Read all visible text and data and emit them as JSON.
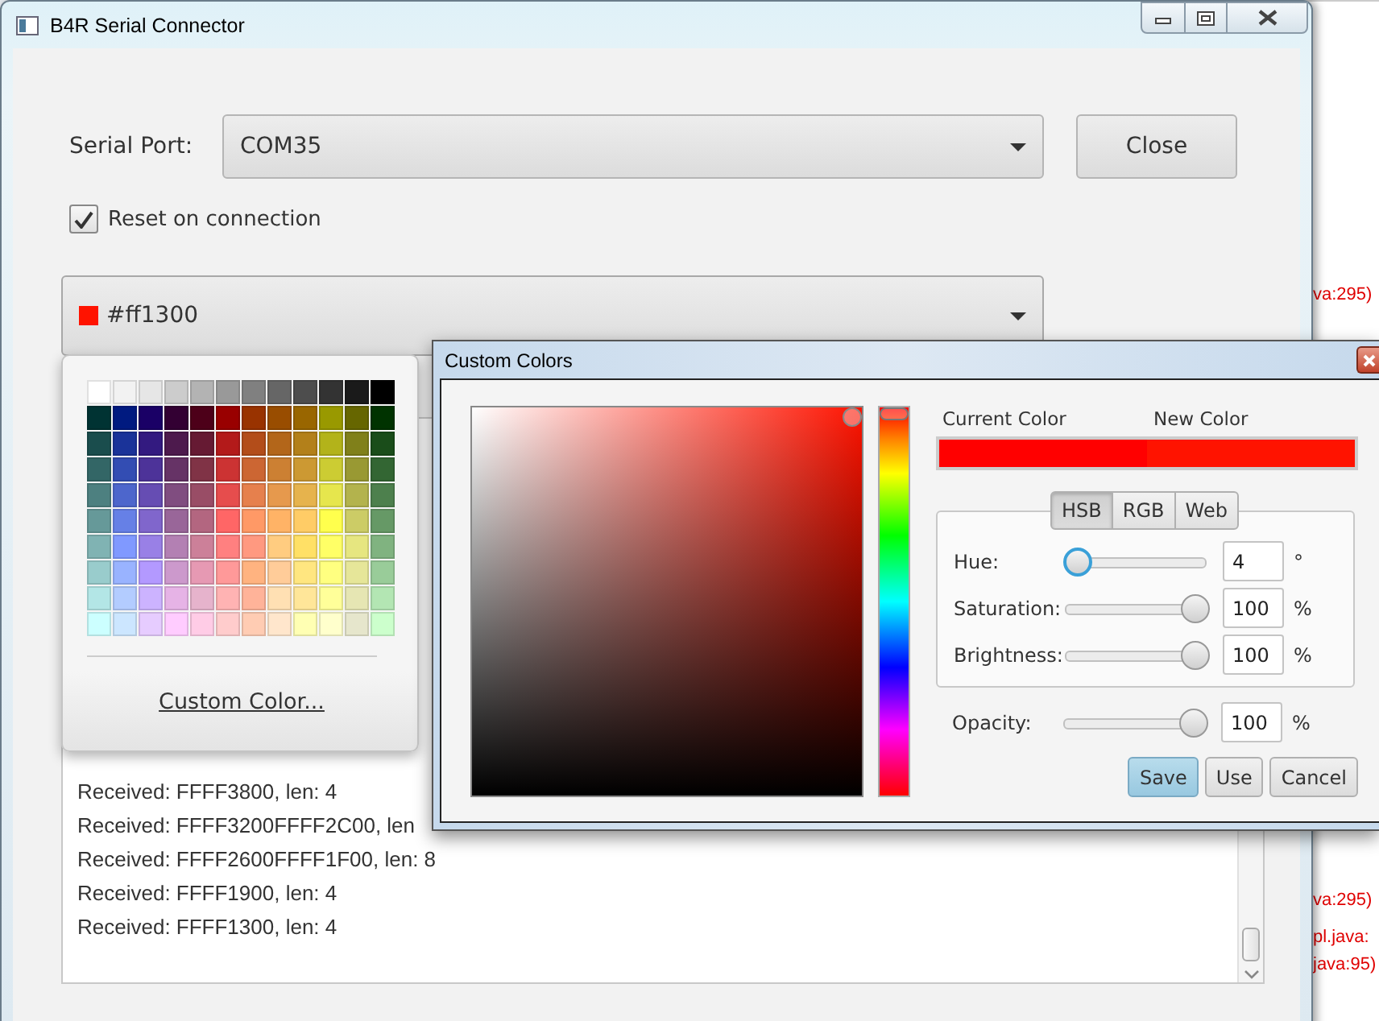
{
  "background_app": {
    "lines": [
      "va:295)",
      "va:295)",
      "pl.java:",
      "java:95)"
    ]
  },
  "window": {
    "title": "B4R Serial Connector"
  },
  "serial_port": {
    "label": "Serial Port:",
    "value": "COM35"
  },
  "close_button": "Close",
  "reset_checkbox": {
    "label": "Reset on connection",
    "checked": true
  },
  "color_picker": {
    "value": "#ff1300",
    "color": "#ff1300",
    "expanded": true
  },
  "log": {
    "lines": [
      "Received: FFFF3800, len: 4",
      "Received: FFFF3200FFFF2C00, len",
      "Received: FFFF2600FFFF1F00, len: 8",
      "Received: FFFF1900, len: 4",
      "Received: FFFF1300, len: 4"
    ]
  },
  "palette": {
    "rows": [
      {
        "swatches": [
          {
            "color": "#ffffff"
          },
          {
            "color": "#f2f2f2"
          },
          {
            "color": "#e6e6e6"
          },
          {
            "color": "#cccccc"
          },
          {
            "color": "#b3b3b3"
          },
          {
            "color": "#999999"
          },
          {
            "color": "#808080"
          },
          {
            "color": "#666666"
          },
          {
            "color": "#4d4d4d"
          },
          {
            "color": "#333333"
          },
          {
            "color": "#1a1a1a"
          },
          {
            "color": "#000000"
          }
        ]
      },
      {
        "swatches": [
          {
            "color": "#003333"
          },
          {
            "color": "#001a80"
          },
          {
            "color": "#1a0066"
          },
          {
            "color": "#330033"
          },
          {
            "color": "#4d0019"
          },
          {
            "color": "#990000"
          },
          {
            "color": "#993300"
          },
          {
            "color": "#994d00"
          },
          {
            "color": "#996600"
          },
          {
            "color": "#999900"
          },
          {
            "color": "#666600"
          },
          {
            "color": "#003300"
          }
        ]
      },
      {
        "swatches": [
          {
            "color": "#1a4d4d"
          },
          {
            "color": "#1a3399"
          },
          {
            "color": "#331a80"
          },
          {
            "color": "#4d1a4d"
          },
          {
            "color": "#661a33"
          },
          {
            "color": "#b31a1a"
          },
          {
            "color": "#b34d1a"
          },
          {
            "color": "#b3661a"
          },
          {
            "color": "#b3801a"
          },
          {
            "color": "#b3b31a"
          },
          {
            "color": "#80801a"
          },
          {
            "color": "#1a4d1a"
          }
        ]
      },
      {
        "swatches": [
          {
            "color": "#336666"
          },
          {
            "color": "#334db3"
          },
          {
            "color": "#4d3399"
          },
          {
            "color": "#663366"
          },
          {
            "color": "#803346"
          },
          {
            "color": "#cc3333"
          },
          {
            "color": "#cc6633"
          },
          {
            "color": "#cc8033"
          },
          {
            "color": "#cc9933"
          },
          {
            "color": "#cccc33"
          },
          {
            "color": "#999933"
          },
          {
            "color": "#336633"
          }
        ]
      },
      {
        "swatches": [
          {
            "color": "#4d8080"
          },
          {
            "color": "#4d66cc"
          },
          {
            "color": "#664db3"
          },
          {
            "color": "#804d80"
          },
          {
            "color": "#994d66"
          },
          {
            "color": "#e64d4d"
          },
          {
            "color": "#e6804d"
          },
          {
            "color": "#e6994d"
          },
          {
            "color": "#e6b34d"
          },
          {
            "color": "#e6e64d"
          },
          {
            "color": "#b3b34d"
          },
          {
            "color": "#4d804d"
          }
        ]
      },
      {
        "swatches": [
          {
            "color": "#669999"
          },
          {
            "color": "#6680e6"
          },
          {
            "color": "#8066cc"
          },
          {
            "color": "#996699"
          },
          {
            "color": "#b36680"
          },
          {
            "color": "#ff6666"
          },
          {
            "color": "#ff9966"
          },
          {
            "color": "#ffb366"
          },
          {
            "color": "#ffcc66"
          },
          {
            "color": "#ffff4d"
          },
          {
            "color": "#cccc66"
          },
          {
            "color": "#669966"
          }
        ]
      },
      {
        "swatches": [
          {
            "color": "#80b3b3"
          },
          {
            "color": "#8099ff"
          },
          {
            "color": "#9980e6"
          },
          {
            "color": "#b380b3"
          },
          {
            "color": "#cc8099"
          },
          {
            "color": "#ff8080"
          },
          {
            "color": "#ff9980"
          },
          {
            "color": "#ffcc80"
          },
          {
            "color": "#ffe066"
          },
          {
            "color": "#ffff66"
          },
          {
            "color": "#e6e680"
          },
          {
            "color": "#80b380"
          }
        ]
      },
      {
        "swatches": [
          {
            "color": "#99cccc"
          },
          {
            "color": "#99b3ff"
          },
          {
            "color": "#b399ff"
          },
          {
            "color": "#cc99cc"
          },
          {
            "color": "#e699b3"
          },
          {
            "color": "#ff9999"
          },
          {
            "color": "#ffb380"
          },
          {
            "color": "#ffcc99"
          },
          {
            "color": "#ffe680"
          },
          {
            "color": "#ffff80"
          },
          {
            "color": "#e6e699"
          },
          {
            "color": "#99cc99"
          }
        ]
      },
      {
        "swatches": [
          {
            "color": "#b3e6e6"
          },
          {
            "color": "#b3ccff"
          },
          {
            "color": "#ccb3ff"
          },
          {
            "color": "#e6b3e6"
          },
          {
            "color": "#e6b3cc"
          },
          {
            "color": "#ffb3b3"
          },
          {
            "color": "#ffb399"
          },
          {
            "color": "#ffe0b3"
          },
          {
            "color": "#ffe699"
          },
          {
            "color": "#ffff99"
          },
          {
            "color": "#e6e6b3"
          },
          {
            "color": "#b3e6b3"
          }
        ]
      },
      {
        "swatches": [
          {
            "color": "#ccffff"
          },
          {
            "color": "#cce6ff"
          },
          {
            "color": "#e6ccff"
          },
          {
            "color": "#ffccff"
          },
          {
            "color": "#ffcce6"
          },
          {
            "color": "#ffcccc"
          },
          {
            "color": "#ffccb3"
          },
          {
            "color": "#ffe6cc"
          },
          {
            "color": "#ffffb3"
          },
          {
            "color": "#ffffcc"
          },
          {
            "color": "#e6e6cc"
          },
          {
            "color": "#ccffcc"
          }
        ]
      }
    ],
    "custom_link": "Custom Color..."
  },
  "custom_colors_dialog": {
    "title": "Custom Colors",
    "hue_slider": {
      "level": 0
    },
    "swatches": [
      {
        "label": "Current Color",
        "color": "#ff0000"
      },
      {
        "label": "New Color",
        "color": "#ff1300"
      }
    ],
    "tabs": [
      {
        "label": "HSB",
        "selected": true
      },
      {
        "label": "RGB",
        "selected": false
      },
      {
        "label": "Web",
        "selected": false
      }
    ],
    "sliders": [
      {
        "label": "Hue:",
        "level": 0.011,
        "value": "4",
        "unit": "°",
        "focused": true
      },
      {
        "label": "Saturation:",
        "level": 1,
        "value": "100",
        "unit": "%",
        "focused": false
      },
      {
        "label": "Brightness:",
        "level": 1,
        "value": "100",
        "unit": "%",
        "focused": false
      }
    ],
    "opacity": {
      "label": "Opacity:",
      "level": 1,
      "value": "100",
      "unit": "%",
      "focused": false
    },
    "buttons": [
      {
        "label": "Save",
        "default": true
      },
      {
        "label": "Use",
        "default": false
      },
      {
        "label": "Cancel",
        "default": false
      }
    ]
  }
}
